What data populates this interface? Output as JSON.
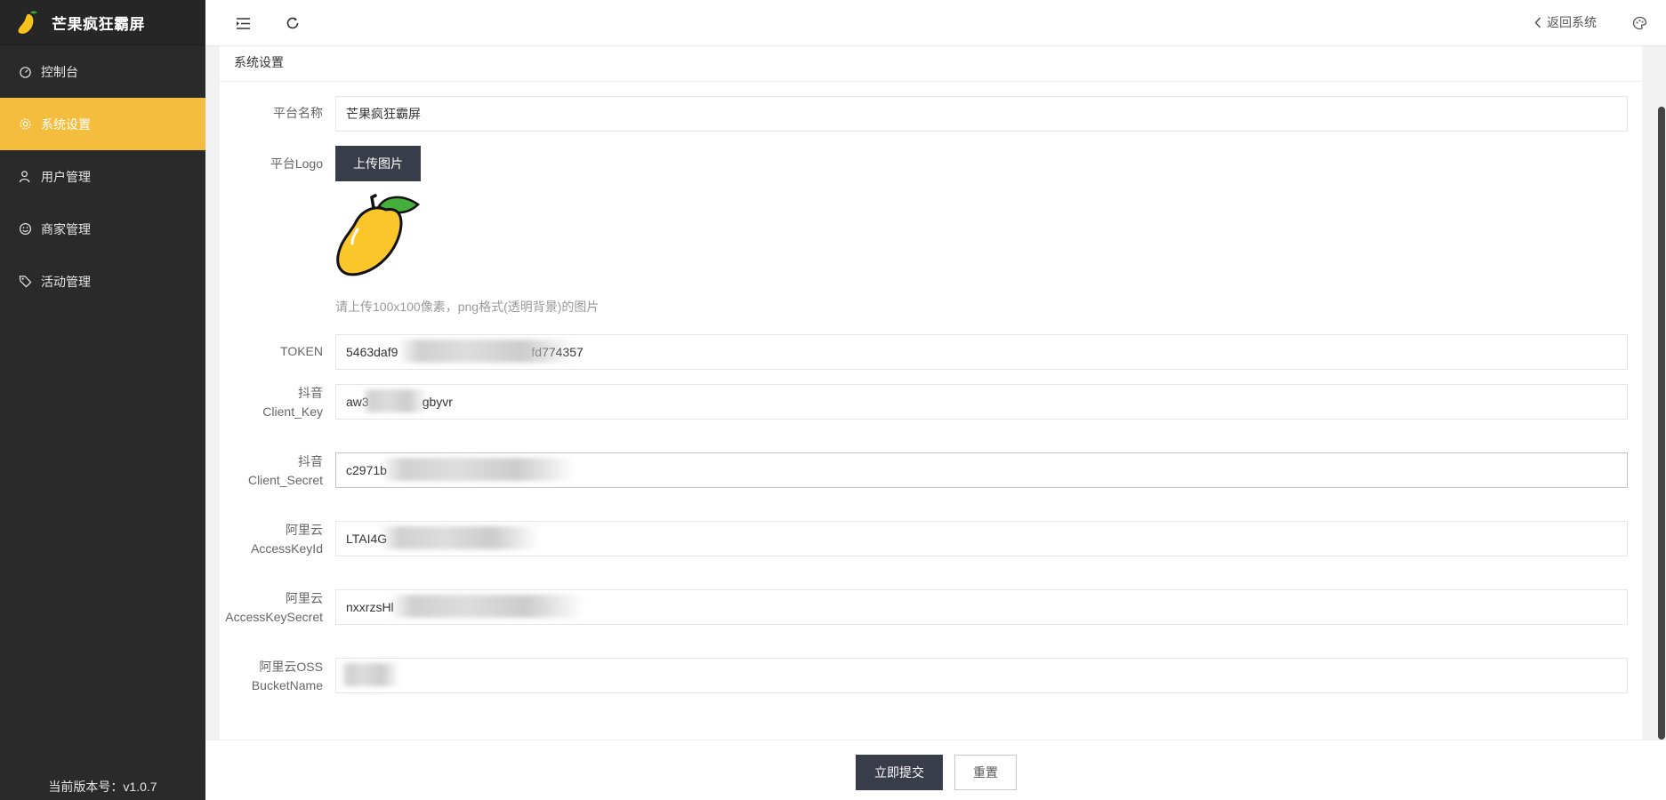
{
  "app": {
    "title": "芒果疯狂霸屏",
    "logo_icon": "mango-icon",
    "version_text": "当前版本号：v1.0.7"
  },
  "sidebar": {
    "items": [
      {
        "label": "控制台",
        "icon": "dashboard-icon",
        "active": false
      },
      {
        "label": "系统设置",
        "icon": "gear-icon",
        "active": true
      },
      {
        "label": "用户管理",
        "icon": "user-icon",
        "active": false
      },
      {
        "label": "商家管理",
        "icon": "smile-icon",
        "active": false
      },
      {
        "label": "活动管理",
        "icon": "tag-icon",
        "active": false
      }
    ]
  },
  "topbar": {
    "back_label": "返回系统"
  },
  "page": {
    "heading": "系统设置"
  },
  "form": {
    "platform_name": {
      "label": "平台名称",
      "value": "芒果疯狂霸屏"
    },
    "platform_logo": {
      "label": "平台Logo",
      "button": "上传图片",
      "hint": "请上传100x100像素，png格式(透明背景)的图片"
    },
    "token": {
      "label": "TOKEN",
      "value_start": "5463daf9",
      "value_end": "fd774357"
    },
    "douyin_client_key": {
      "label_line1": "抖音",
      "label_line2": "Client_Key",
      "value_start": "aw3",
      "value_end": "gbyvr"
    },
    "douyin_client_secret": {
      "label_line1": "抖音",
      "label_line2": "Client_Secret",
      "value_start": "c2971b",
      "value_end": ""
    },
    "aliyun_access_key_id": {
      "label_line1": "阿里云",
      "label_line2": "AccessKeyId",
      "value_start": "LTAI4G",
      "value_end": ""
    },
    "aliyun_access_key_secret": {
      "label_line1": "阿里云",
      "label_line2": "AccessKeySecret",
      "value_start": "nxxrzsHl",
      "value_end": ""
    },
    "aliyun_oss_bucket": {
      "label_line1": "阿里云OSS",
      "label_line2": "BucketName",
      "value_start": "",
      "value_end": ""
    }
  },
  "footer": {
    "submit_label": "立即提交",
    "reset_label": "重置"
  },
  "colors": {
    "sidebar_bg": "#2a2a2a",
    "active_item": "#f5bd3e",
    "primary_button": "#393d49"
  }
}
